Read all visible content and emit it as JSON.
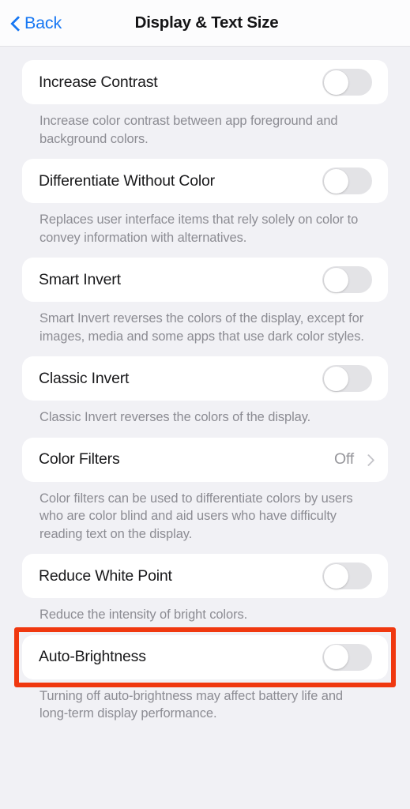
{
  "header": {
    "back_label": "Back",
    "back_icon": "chevron-left-icon",
    "title": "Display & Text Size"
  },
  "colors": {
    "accent_blue": "#1878F3",
    "highlight_red": "#F0380F",
    "page_background": "#F1F1F5",
    "card_background": "#FFFFFF",
    "footnote_text": "#8C8C93",
    "toggle_off_track": "#E3E3E6"
  },
  "settings": [
    {
      "label": "Increase Contrast",
      "control": "toggle",
      "state": "off",
      "footnote": "Increase color contrast between app foreground and background colors.",
      "highlighted": false
    },
    {
      "label": "Differentiate Without Color",
      "control": "toggle",
      "state": "off",
      "footnote": "Replaces user interface items that rely solely on color to convey information with alternatives.",
      "highlighted": false
    },
    {
      "label": "Smart Invert",
      "control": "toggle",
      "state": "off",
      "footnote": "Smart Invert reverses the colors of the display, except for images, media and some apps that use dark color styles.",
      "highlighted": false
    },
    {
      "label": "Classic Invert",
      "control": "toggle",
      "state": "off",
      "footnote": "Classic Invert reverses the colors of the display.",
      "highlighted": false
    },
    {
      "label": "Color Filters",
      "control": "disclosure",
      "value": "Off",
      "footnote": "Color filters can be used to differentiate colors by users who are color blind and aid users who have difficulty reading text on the display.",
      "highlighted": false
    },
    {
      "label": "Reduce White Point",
      "control": "toggle",
      "state": "off",
      "footnote": "Reduce the intensity of bright colors.",
      "highlighted": false
    },
    {
      "label": "Auto-Brightness",
      "control": "toggle",
      "state": "off",
      "footnote": "Turning off auto-brightness may affect battery life and long-term display performance.",
      "highlighted": true
    }
  ]
}
